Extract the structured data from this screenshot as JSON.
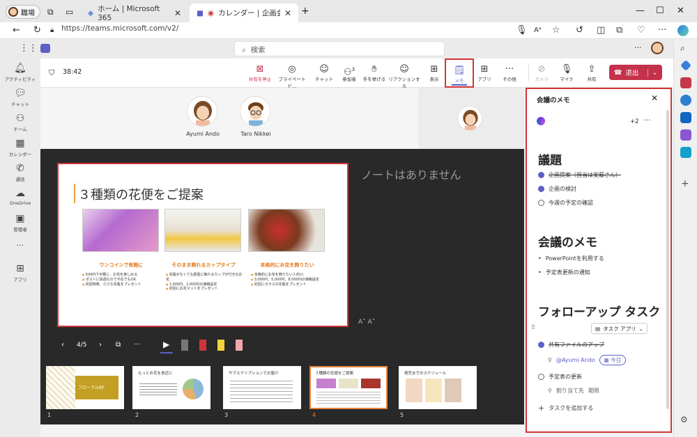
{
  "browser": {
    "profile_label": "職場",
    "tabs": [
      {
        "title": "ホーム | Microsoft 365",
        "active": false
      },
      {
        "title": "カレンダー | 企画会議 | Micros",
        "active": true
      }
    ],
    "new_tab": "+",
    "url": "https://teams.microsoft.com/v2/",
    "window_controls": [
      "—",
      "☐",
      "✕"
    ]
  },
  "teams": {
    "search_placeholder": "検索",
    "header_more": "···"
  },
  "rail": [
    {
      "label": "アクティビティ",
      "icon": "bell-icon"
    },
    {
      "label": "チャット",
      "icon": "chat-icon"
    },
    {
      "label": "チーム",
      "icon": "teams-icon"
    },
    {
      "label": "カレンダー",
      "icon": "calendar-icon"
    },
    {
      "label": "通話",
      "icon": "phone-icon"
    },
    {
      "label": "OneDrive",
      "icon": "cloud-icon"
    },
    {
      "label": "管理者",
      "icon": "admin-icon"
    },
    {
      "label": "···",
      "icon": "more-icon"
    },
    {
      "label": "アプリ",
      "icon": "apps-icon"
    }
  ],
  "meeting": {
    "timer": "38:42",
    "toolbar": [
      {
        "label": "共有を停止",
        "icon": "stop-share-icon",
        "red": true
      },
      {
        "label": "プライベートビ...",
        "icon": "eye-icon"
      },
      {
        "label": "チャット",
        "icon": "chat-icon"
      },
      {
        "label": "参加者",
        "icon": "people-icon",
        "badge": "3"
      },
      {
        "label": "手を挙げる",
        "icon": "hand-icon"
      },
      {
        "label": "リアクションする",
        "icon": "smile-icon"
      },
      {
        "label": "表示",
        "icon": "view-icon"
      },
      {
        "label": "メモ",
        "icon": "notes-icon",
        "selected": true
      },
      {
        "label": "アプリ",
        "icon": "add-app-icon"
      },
      {
        "label": "その他",
        "icon": "more-icon"
      },
      {
        "label": "カメラ",
        "icon": "camera-off-icon",
        "disabled": true
      },
      {
        "label": "マイク",
        "icon": "mic-off-icon"
      },
      {
        "label": "共有",
        "icon": "share-icon"
      }
    ],
    "leave_label": "退出",
    "participants": [
      {
        "name": "Ayumi Ando"
      },
      {
        "name": "Taro Nikkei"
      }
    ]
  },
  "slide": {
    "title": "３種類の花便をご提案",
    "columns": [
      {
        "heading": "ワンコインで気軽に",
        "bullets": [
          "500円で手軽に、お花を楽しめる",
          "ポストに投函なので不在でもOK",
          "初回特典、小さな花瓶をプレゼント"
        ]
      },
      {
        "heading": "そのまま飾れるカップタイプ",
        "bullets": [
          "花瓶がなくても部屋に飾れるカップが付きのお花",
          "1,000円、2,000円の価格設定",
          "初回にお花マットをプレゼント"
        ]
      },
      {
        "heading": "本格的にお花を飾りたい",
        "bullets": [
          "本格的にお花を飾りたい人向け。",
          "3,000円、5,000円、8,000円の価格設定",
          "初回にガラスの花瓶をプレゼント"
        ]
      }
    ],
    "no_notes": "ノートはありません",
    "font_controls": "A˄ A˅",
    "page_indicator": "4/5"
  },
  "thumbnails": [
    {
      "num": "1",
      "caption": "フローラルBP"
    },
    {
      "num": "2",
      "caption": "もっとお花を身近に"
    },
    {
      "num": "3",
      "caption": "サブスクリプションでお届け"
    },
    {
      "num": "4",
      "caption": "３種類の花便をご提案",
      "selected": true
    },
    {
      "num": "5",
      "caption": "発売までのスケジュール"
    }
  ],
  "notes_panel": {
    "title": "会議のメモ",
    "collab_count": "+2",
    "more": "···",
    "sections": [
      {
        "heading": "議題",
        "items": [
          {
            "text": "企画提案（担当は安藤さん）",
            "done": true
          },
          {
            "text": "企画の検討",
            "done": true
          },
          {
            "text": "今週の予定の確認",
            "done": false
          }
        ]
      },
      {
        "heading": "会議のメモ",
        "bullets": [
          "PowerPointを利用する",
          "予定表更新の通知"
        ]
      }
    ],
    "followup": {
      "heading": "フォローアップ タスク",
      "app_button": "タスク アプリ",
      "tasks": [
        {
          "text": "共有ファイルのアップ",
          "done": true,
          "assignee": "@Ayumi Ando",
          "due": "今日"
        },
        {
          "text": "予定表の更新",
          "done": false,
          "assignee": "割り当て先",
          "due": "期限"
        }
      ],
      "add_task": "タスクを追加する"
    }
  },
  "colors": {
    "accent": "#5b5fc7",
    "highlight": "#d13438",
    "leave": "#c4314b",
    "slide_accent": "#e07b1f"
  }
}
